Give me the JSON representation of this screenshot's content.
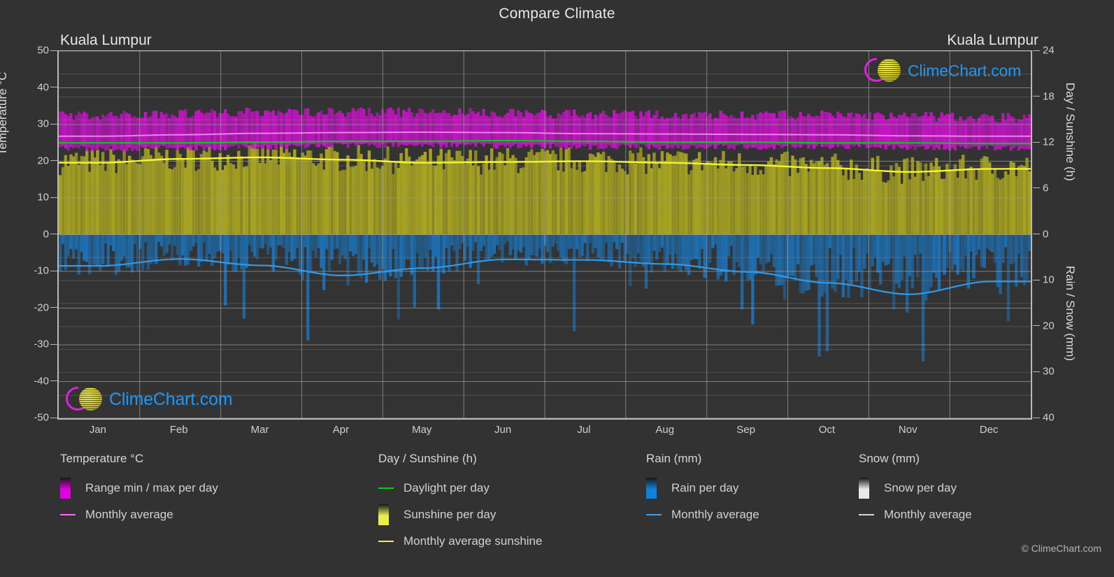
{
  "header": {
    "title": "Compare Climate",
    "location_left": "Kuala Lumpur",
    "location_right": "Kuala Lumpur"
  },
  "watermark": {
    "text": "ClimeChart.com",
    "copyright": "© ClimeChart.com"
  },
  "axes": {
    "left_title": "Temperature °C",
    "right_top_title": "Day / Sunshine (h)",
    "right_bottom_title": "Rain / Snow (mm)",
    "left_ticks": [
      "50",
      "40",
      "30",
      "20",
      "10",
      "0",
      "-10",
      "-20",
      "-30",
      "-40",
      "-50"
    ],
    "right_top_ticks": [
      "24",
      "18",
      "12",
      "6",
      "0"
    ],
    "right_bottom_ticks": [
      "10",
      "20",
      "30",
      "40"
    ],
    "x_ticks": [
      "Jan",
      "Feb",
      "Mar",
      "Apr",
      "May",
      "Jun",
      "Jul",
      "Aug",
      "Sep",
      "Oct",
      "Nov",
      "Dec"
    ]
  },
  "legend": {
    "groups": [
      {
        "title": "Temperature °C",
        "items": [
          {
            "label": "Range min / max per day",
            "key": "swatch",
            "color": "#e000e0"
          },
          {
            "label": "Monthly average",
            "key": "line",
            "color": "#e87ae8"
          }
        ]
      },
      {
        "title": "Day / Sunshine (h)",
        "items": [
          {
            "label": "Daylight per day",
            "key": "line",
            "color": "#00d015"
          },
          {
            "label": "Sunshine per day",
            "key": "swatch",
            "color": "#eded4a"
          },
          {
            "label": "Monthly average sunshine",
            "key": "line",
            "color": "#f2f234"
          }
        ]
      },
      {
        "title": "Rain (mm)",
        "items": [
          {
            "label": "Rain per day",
            "key": "swatch",
            "color": "#1081d8"
          },
          {
            "label": "Monthly average",
            "key": "line",
            "color": "#3ca0ee"
          }
        ]
      },
      {
        "title": "Snow (mm)",
        "items": [
          {
            "label": "Snow per day",
            "key": "swatch",
            "color": "#e8e8e8"
          },
          {
            "label": "Monthly average",
            "key": "line",
            "color": "#d8d8d8"
          }
        ]
      }
    ]
  },
  "colors": {
    "background": "#323232",
    "plot_background": "#333333",
    "grid": "#8e8e8e",
    "axis": "#b9b9b9",
    "text": "#d0d0d0",
    "temp_range": "#c215c2",
    "temp_avg": "#ee80ee",
    "daylight": "#00d015",
    "sunshine_band": "#a9a522",
    "sunshine_avg": "#f5f52e",
    "rain_band": "#1d72b8",
    "rain_avg": "#2f9ae8",
    "logo_text": "#2196f3",
    "logo_arc": "#e020e0",
    "logo_ball": "#d8d330"
  },
  "chart_data": {
    "type": "area",
    "title": "Compare Climate",
    "subtitle": "Kuala Lumpur",
    "xlabel": "",
    "ylabel": "Temperature °C",
    "categories": [
      "Jan",
      "Feb",
      "Mar",
      "Apr",
      "May",
      "Jun",
      "Jul",
      "Aug",
      "Sep",
      "Oct",
      "Nov",
      "Dec"
    ],
    "grid": true,
    "legend_position": "bottom",
    "axis_left": {
      "label": "Temperature °C",
      "min": -50,
      "max": 50,
      "step": 10,
      "unit": "°C"
    },
    "axis_right_top": {
      "label": "Day / Sunshine (h)",
      "min": 0,
      "max": 24,
      "step": 6,
      "unit": "h"
    },
    "axis_right_bottom": {
      "label": "Rain / Snow (mm)",
      "min": 0,
      "max": 40,
      "step": 10,
      "unit": "mm"
    },
    "series": [
      {
        "name": "Monthly average",
        "group": "Temperature °C",
        "unit": "°C",
        "axis": "left",
        "color": "#ee80ee",
        "values": [
          26.8,
          27.2,
          27.6,
          27.8,
          27.9,
          27.8,
          27.5,
          27.4,
          27.3,
          27.2,
          26.9,
          26.8
        ]
      },
      {
        "name": "Range min / max per day",
        "group": "Temperature °C",
        "unit": "°C",
        "axis": "left",
        "color": "#c215c2",
        "min_values": [
          23.4,
          23.6,
          23.9,
          24.3,
          24.5,
          24.2,
          23.9,
          23.9,
          23.9,
          23.9,
          23.8,
          23.6
        ],
        "max_values": [
          32.3,
          33.0,
          33.3,
          33.3,
          33.2,
          33.0,
          32.6,
          32.5,
          32.4,
          32.5,
          32.0,
          31.8
        ]
      },
      {
        "name": "Daylight per day",
        "group": "Day / Sunshine (h)",
        "unit": "h",
        "axis": "right_top",
        "color": "#00d015",
        "values": [
          12.0,
          12.0,
          12.1,
          12.2,
          12.2,
          12.3,
          12.2,
          12.1,
          12.1,
          12.0,
          12.0,
          11.9
        ]
      },
      {
        "name": "Monthly average sunshine",
        "group": "Day / Sunshine (h)",
        "unit": "h",
        "axis": "right_top",
        "color": "#f5f52e",
        "values": [
          9.4,
          9.9,
          10.1,
          9.8,
          9.4,
          9.5,
          9.6,
          9.4,
          9.1,
          8.7,
          8.2,
          8.6
        ]
      },
      {
        "name": "Monthly average",
        "group": "Rain (mm)",
        "unit": "mm",
        "axis": "right_bottom",
        "color": "#2f9ae8",
        "values": [
          6.8,
          5.3,
          6.7,
          8.9,
          7.3,
          5.4,
          5.5,
          6.4,
          8.1,
          10.5,
          13.0,
          10.2
        ]
      },
      {
        "name": "Monthly average",
        "group": "Snow (mm)",
        "unit": "mm",
        "axis": "right_bottom",
        "color": "#d8d8d8",
        "values": [
          0,
          0,
          0,
          0,
          0,
          0,
          0,
          0,
          0,
          0,
          0,
          0
        ]
      }
    ]
  }
}
